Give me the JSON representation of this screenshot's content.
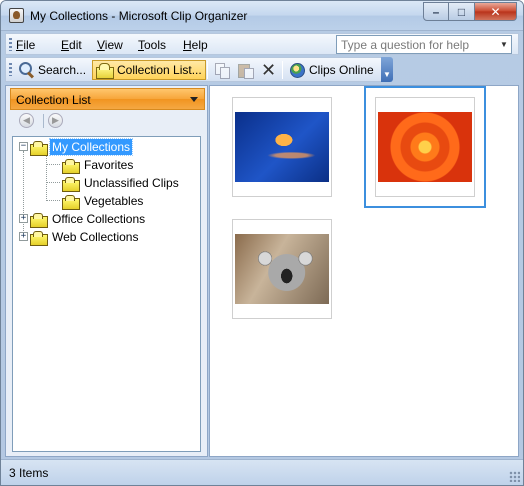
{
  "window": {
    "title": "My Collections - Microsoft Clip Organizer",
    "controls": {
      "minimize": "–",
      "maximize": "□",
      "close": "✕"
    }
  },
  "menu": {
    "items": [
      {
        "underline": "F",
        "rest": "ile"
      },
      {
        "underline": "E",
        "rest": "dit"
      },
      {
        "underline": "V",
        "rest": "iew"
      },
      {
        "underline": "T",
        "rest": "ools"
      },
      {
        "underline": "H",
        "rest": "elp"
      }
    ],
    "help_placeholder": "Type a question for help"
  },
  "toolbar": {
    "search_label": "Search...",
    "collection_list_label": "Collection List...",
    "clips_online_label": "Clips Online",
    "icons": [
      "search-icon",
      "folder-icon",
      "copy-icon",
      "paste-icon",
      "delete-icon",
      "globe-icon"
    ]
  },
  "task_pane": {
    "title": "Collection List",
    "tree": {
      "root_label": "My Collections",
      "children": [
        "Favorites",
        "Unclassified Clips",
        "Vegetables"
      ],
      "siblings": [
        "Office Collections",
        "Web Collections"
      ]
    }
  },
  "clips": [
    {
      "name": "jellyfish"
    },
    {
      "name": "orange flower",
      "selected": true
    },
    {
      "name": "koala"
    }
  ],
  "status": {
    "text": "3 Items"
  }
}
